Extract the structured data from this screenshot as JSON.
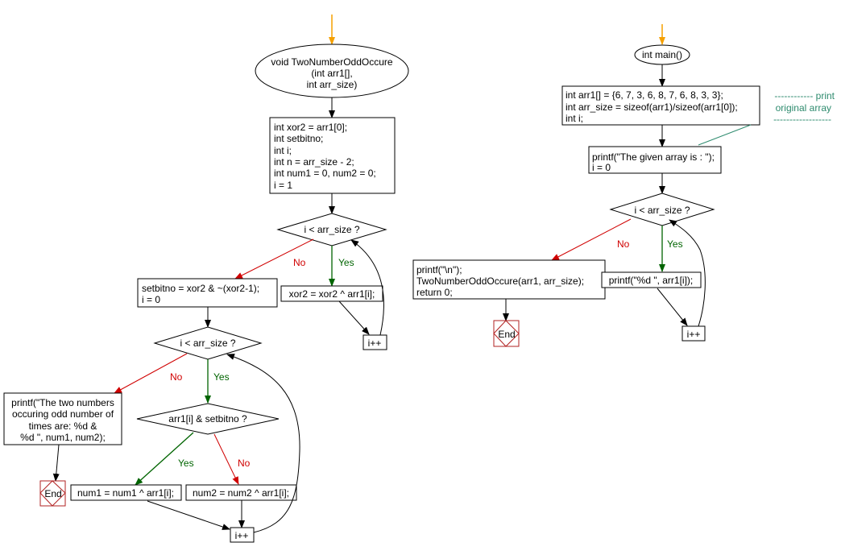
{
  "colors": {
    "start_arrow": "#f5a000",
    "no_branch": "#d00000",
    "yes_branch": "#006400",
    "comment": "#2e8b6e",
    "end": "#b22222"
  },
  "left": {
    "start": [
      "void TwoNumberOddOccure",
      "(int arr1[],",
      "int arr_size)"
    ],
    "init": [
      "int xor2 = arr1[0];",
      "int setbitno;",
      "int i;",
      "int n = arr_size - 2;",
      "int num1 = 0, num2 = 0;",
      "i = 1"
    ],
    "cond1": "i < arr_size ?",
    "xor_step": "xor2 = xor2 ^ arr1[i];",
    "inc1": "i++",
    "setbit": [
      "setbitno = xor2 & ~(xor2-1);",
      "i = 0"
    ],
    "cond2": "i < arr_size ?",
    "print": [
      "printf(\"The two numbers",
      "occuring odd number of",
      "times are: %d &",
      "%d \", num1, num2);"
    ],
    "end": "End",
    "cond3": "arr1[i] & setbitno ?",
    "num1": "num1 = num1 ^ arr1[i];",
    "num2": "num2 = num2 ^ arr1[i];",
    "inc2": "i++"
  },
  "right": {
    "start": "int main()",
    "init": [
      "int arr1[] = {6, 7, 3, 6, 8, 7, 6, 8, 3, 3};",
      "int arr_size = sizeof(arr1)/sizeof(arr1[0]);",
      "int i;"
    ],
    "comment": [
      "------------ print",
      "original array",
      "------------------"
    ],
    "print_given": [
      "printf(\"The given array is :  \");",
      "i = 0"
    ],
    "cond": "i < arr_size ?",
    "print_elem": "printf(\"%d  \", arr1[i]);",
    "inc": "i++",
    "final": [
      "printf(\"\\n\");",
      "TwoNumberOddOccure(arr1, arr_size);",
      "return 0;"
    ],
    "end": "End"
  },
  "labels": {
    "yes": "Yes",
    "no": "No"
  }
}
